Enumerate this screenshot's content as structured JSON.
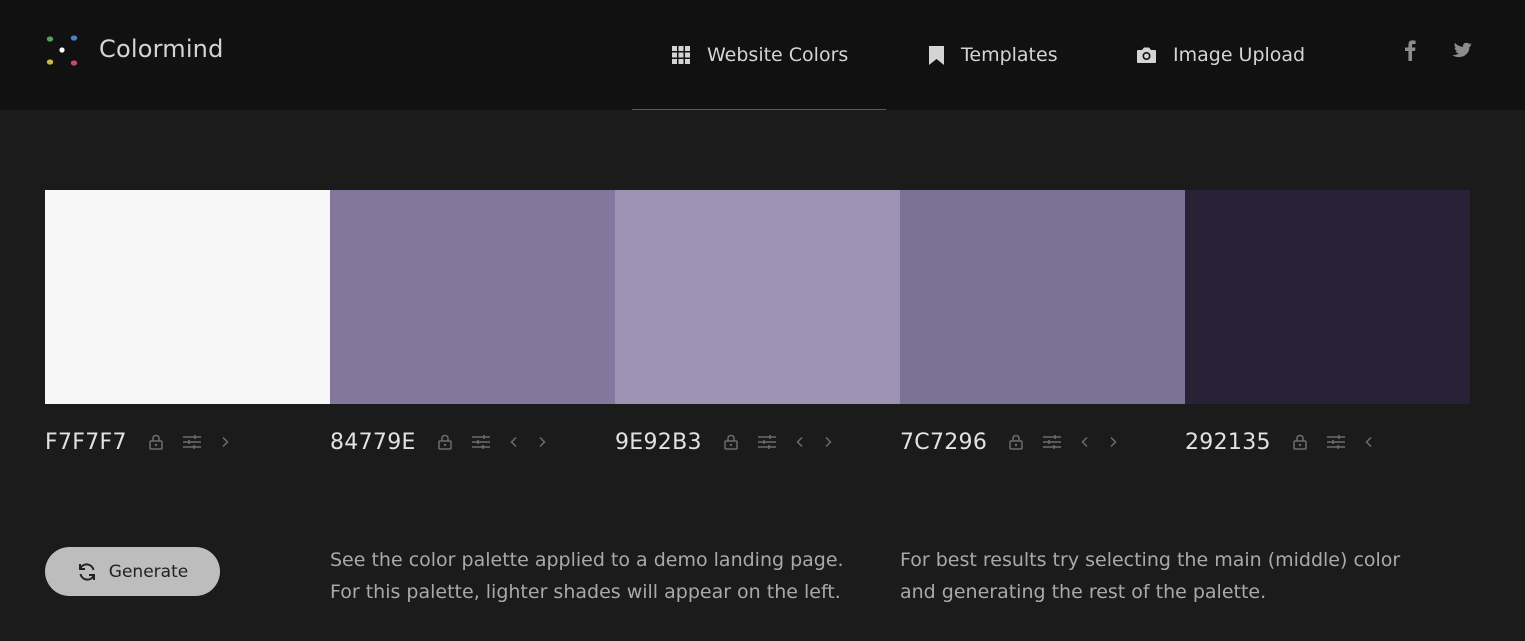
{
  "header": {
    "brand": "Colormind",
    "nav": [
      {
        "label": "Website Colors",
        "icon": "grid-icon"
      },
      {
        "label": "Templates",
        "icon": "bookmark-icon"
      },
      {
        "label": "Image Upload",
        "icon": "camera-icon"
      }
    ],
    "social": [
      "facebook-icon",
      "twitter-icon"
    ]
  },
  "palette": [
    {
      "hex": "F7F7F7",
      "color": "#F7F7F7"
    },
    {
      "hex": "84779E",
      "color": "#84779E"
    },
    {
      "hex": "9E92B3",
      "color": "#9E92B3"
    },
    {
      "hex": "7C7296",
      "color": "#7C7296"
    },
    {
      "hex": "292135",
      "color": "#292135"
    }
  ],
  "generate_label": "Generate",
  "info": {
    "demo_line1": "See the color palette applied to a demo landing page.",
    "demo_line2": "For this palette, lighter shades will appear on the left.",
    "tip_line1": "For best results try selecting the main (middle) color",
    "tip_line2": "and generating the rest of the palette."
  }
}
